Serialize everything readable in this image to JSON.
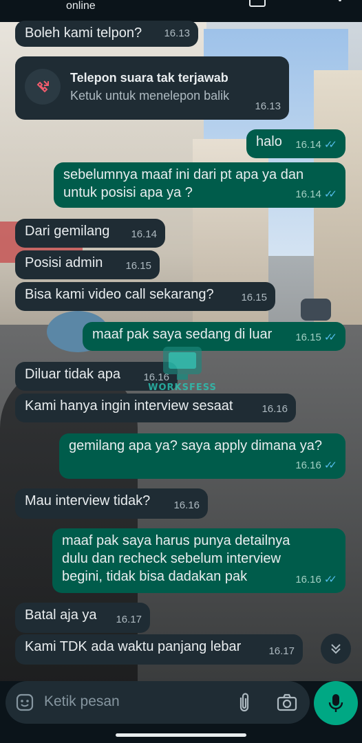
{
  "header": {
    "status": "online"
  },
  "messages": [
    {
      "id": "m1",
      "dir": "in",
      "text": "Boleh kami telpon?",
      "time": "16.13"
    },
    {
      "id": "m3",
      "dir": "out",
      "text": "halo",
      "time": "16.14"
    },
    {
      "id": "m4",
      "dir": "out",
      "text": "sebelumnya maaf ini dari pt apa ya dan\nuntuk posisi apa ya ?",
      "time": "16.14"
    },
    {
      "id": "m5",
      "dir": "in",
      "text": "Dari gemilang",
      "time": "16.14"
    },
    {
      "id": "m6",
      "dir": "in",
      "text": "Posisi admin",
      "time": "16.15"
    },
    {
      "id": "m7",
      "dir": "in",
      "text": "Bisa kami video call sekarang?",
      "time": "16.15"
    },
    {
      "id": "m8",
      "dir": "out",
      "text": "maaf pak saya sedang di luar",
      "time": "16.15"
    },
    {
      "id": "m9",
      "dir": "in",
      "text": "Diluar tidak apa",
      "time": "16.16"
    },
    {
      "id": "m10",
      "dir": "in",
      "text": "Kami hanya ingin interview sesaat",
      "time": "16.16"
    },
    {
      "id": "m11",
      "dir": "out",
      "text": "gemilang apa ya? saya apply dimana ya?",
      "time": "16.16"
    },
    {
      "id": "m12",
      "dir": "in",
      "text": "Mau interview tidak?",
      "time": "16.16"
    },
    {
      "id": "m13",
      "dir": "out",
      "text": "maaf pak saya harus punya detailnya\ndulu dan recheck sebelum interview\nbegini, tidak bisa dadakan pak",
      "time": "16.16"
    },
    {
      "id": "m14",
      "dir": "in",
      "text": "Batal aja ya",
      "time": "16.17"
    },
    {
      "id": "m15",
      "dir": "in",
      "text": "Kami TDK ada waktu panjang lebar",
      "time": "16.17"
    }
  ],
  "missed_call": {
    "title": "Telepon suara tak terjawab",
    "subtitle": "Ketuk untuk menelepon balik",
    "time": "16.13"
  },
  "watermark": "WORKSFESS",
  "composer": {
    "placeholder": "Ketik pesan"
  },
  "colors": {
    "incoming": "#1f2c34",
    "outgoing": "#005c4b",
    "accent": "#00a884",
    "tick": "#53bdeb",
    "missed": "#f15c6d"
  },
  "icons": [
    "emoji-icon",
    "attach-icon",
    "camera-icon",
    "mic-icon",
    "scroll-down-icon",
    "missed-call-icon",
    "read-ticks-icon"
  ]
}
